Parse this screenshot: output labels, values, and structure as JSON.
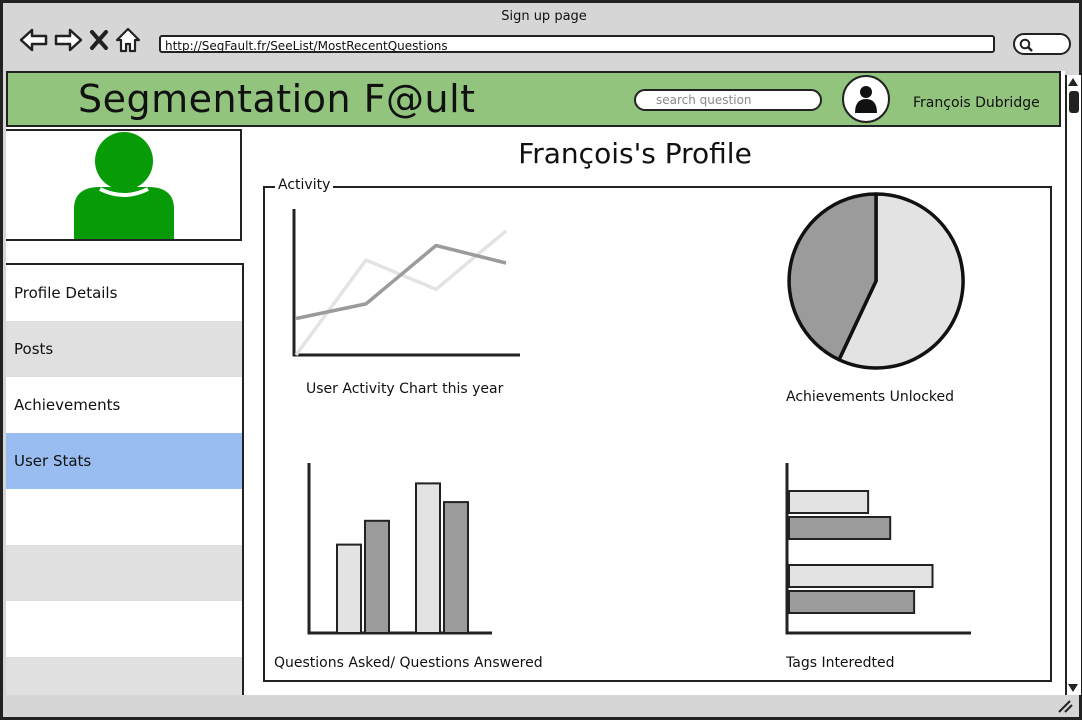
{
  "window": {
    "title": "Sign up page",
    "url": "http://SegFault.fr/SeeList/MostRecentQuestions"
  },
  "header": {
    "brand": "Segmentation F@ult",
    "search_placeholder": "search question",
    "user_name": "François Dubridge"
  },
  "sidebar": {
    "items": [
      {
        "label": "Profile Details"
      },
      {
        "label": "Posts"
      },
      {
        "label": "Achievements"
      },
      {
        "label": "User Stats",
        "selected": true
      },
      {
        "label": ""
      },
      {
        "label": ""
      },
      {
        "label": ""
      },
      {
        "label": ""
      }
    ]
  },
  "main": {
    "title": "François's Profile",
    "section_label": "Activity"
  },
  "colors": {
    "header_green": "#92c47e",
    "avatar_green": "#079b07",
    "selected_blue": "#99bdf0",
    "row_grey": "#e0e0e0",
    "series_dark": "#9b9b9b",
    "series_light": "#e3e3e3"
  },
  "chart_data": [
    {
      "type": "line",
      "title": "User Activity Chart this year",
      "x": [
        0,
        1,
        2,
        3
      ],
      "series": [
        {
          "values": [
            2.5,
            3.5,
            7.5,
            6.3
          ]
        },
        {
          "values": [
            0,
            6.5,
            4.5,
            8.5
          ]
        }
      ],
      "ylim": [
        0,
        10
      ]
    },
    {
      "type": "pie",
      "title": "Achievements Unlocked",
      "values": [
        57,
        43
      ]
    },
    {
      "type": "bar",
      "title": "Questions Asked/ Questions Answered",
      "categories": [
        "",
        ""
      ],
      "series": [
        {
          "values": [
            5.2,
            8.8
          ]
        },
        {
          "values": [
            6.6,
            7.7
          ]
        }
      ],
      "ylim": [
        0,
        10
      ]
    },
    {
      "type": "bar",
      "orientation": "horizontal",
      "title": "Tags Interedted",
      "categories": [
        "",
        ""
      ],
      "series": [
        {
          "values": [
            4.3,
            7.8
          ]
        },
        {
          "values": [
            5.5,
            6.8
          ]
        }
      ],
      "xlim": [
        0,
        10
      ]
    }
  ]
}
